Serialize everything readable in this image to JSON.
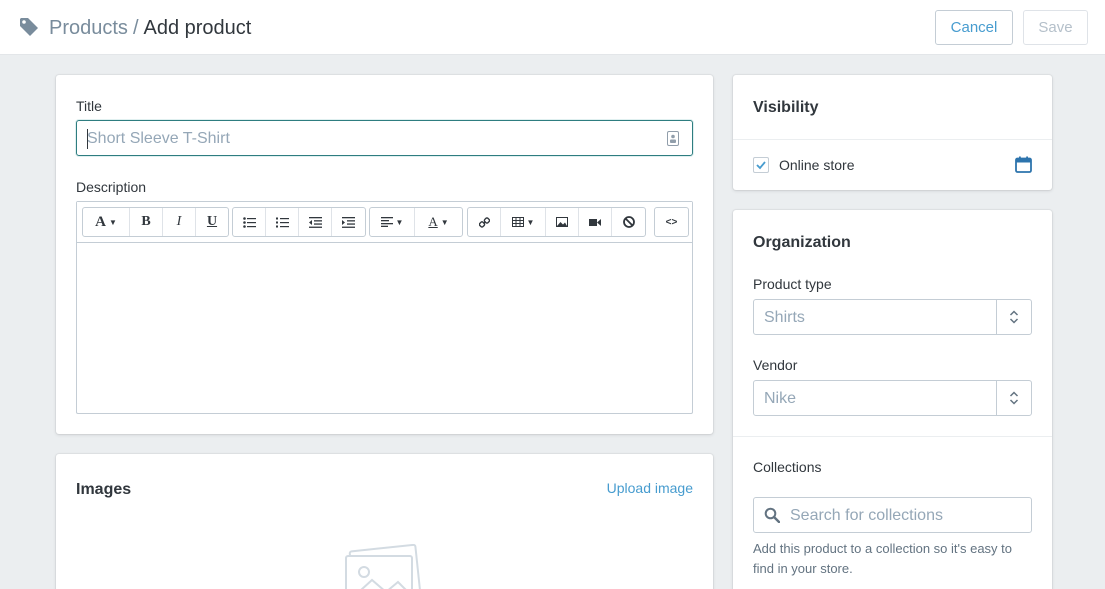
{
  "header": {
    "breadcrumb_parent": "Products",
    "breadcrumb_separator": "/",
    "breadcrumb_current": "Add product",
    "cancel_label": "Cancel",
    "save_label": "Save",
    "tag_icon": "tag-icon"
  },
  "product": {
    "title_label": "Title",
    "title_placeholder": "Short Sleeve T-Shirt",
    "description_label": "Description",
    "toolbar_tools": [
      "font",
      "bold",
      "italic",
      "underline",
      "bulleted-list",
      "numbered-list",
      "outdent",
      "indent",
      "align",
      "text-color",
      "link",
      "table",
      "image",
      "video",
      "clear-formatting",
      "html"
    ]
  },
  "images": {
    "title": "Images",
    "upload_label": "Upload image"
  },
  "visibility": {
    "title": "Visibility",
    "online_store_label": "Online store",
    "online_store_checked": true
  },
  "organization": {
    "title": "Organization",
    "product_type_label": "Product type",
    "product_type_value": "Shirts",
    "vendor_label": "Vendor",
    "vendor_value": "Nike",
    "collections_label": "Collections",
    "collections_placeholder": "Search for collections",
    "collections_help": "Add this product to a collection so it's easy to find in your store."
  },
  "colors": {
    "accent": "#479ccf",
    "focus": "#2e7d80",
    "background": "#ebeef0"
  }
}
